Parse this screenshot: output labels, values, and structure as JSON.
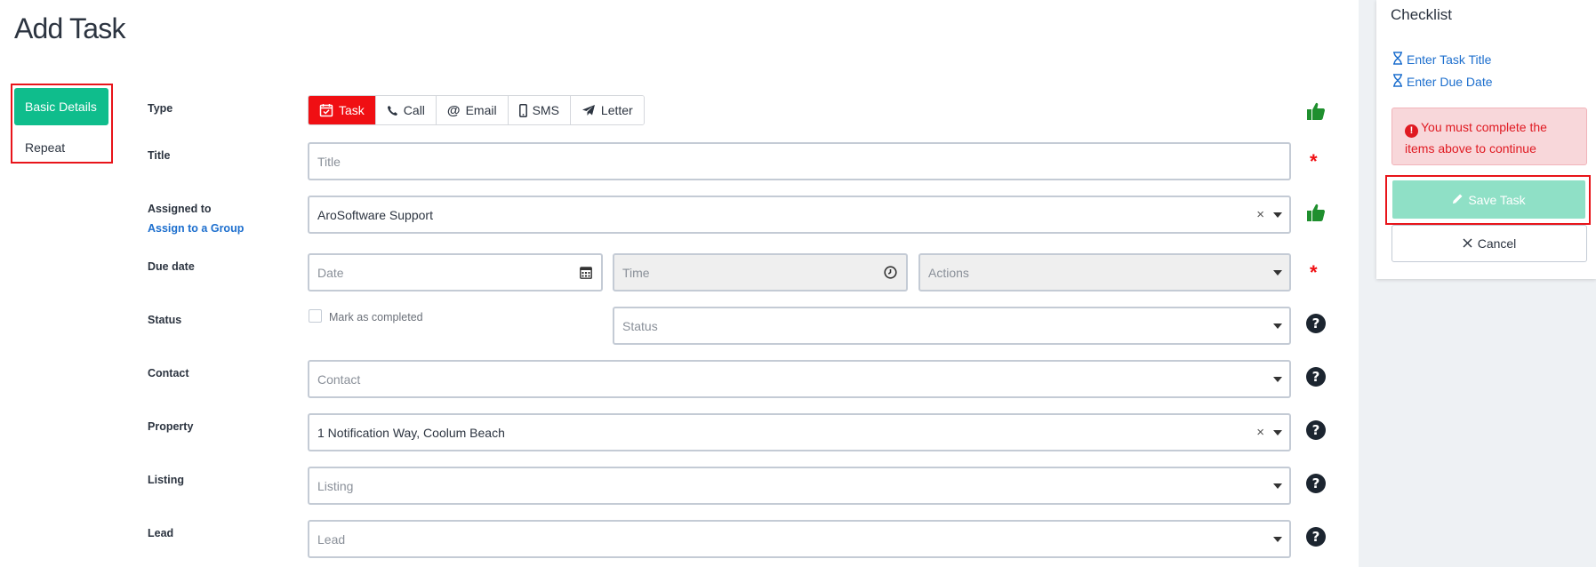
{
  "page": {
    "title": "Add Task"
  },
  "tabs": [
    {
      "label": "Basic Details",
      "active": true
    },
    {
      "label": "Repeat",
      "active": false
    }
  ],
  "form": {
    "type": {
      "label": "Type",
      "options": [
        {
          "label": "Task",
          "icon": "calendar-check-icon",
          "active": true
        },
        {
          "label": "Call",
          "icon": "phone-icon",
          "active": false
        },
        {
          "label": "Email",
          "icon": "at-icon",
          "active": false
        },
        {
          "label": "SMS",
          "icon": "mobile-icon",
          "active": false
        },
        {
          "label": "Letter",
          "icon": "paper-plane-icon",
          "active": false
        }
      ],
      "status_icon": "thumbs-up-icon"
    },
    "title": {
      "label": "Title",
      "placeholder": "Title",
      "status_icon": "required-asterisk-icon"
    },
    "assigned_to": {
      "label": "Assigned to",
      "link": "Assign to a Group",
      "value": "AroSoftware Support",
      "clear": "×",
      "status_icon": "thumbs-up-icon"
    },
    "due_date": {
      "label": "Due date",
      "date_placeholder": "Date",
      "time_placeholder": "Time",
      "actions_placeholder": "Actions",
      "status_icon": "required-asterisk-icon"
    },
    "status": {
      "label": "Status",
      "checkbox_label": "Mark as completed",
      "placeholder": "Status",
      "status_icon": "help-icon"
    },
    "contact": {
      "label": "Contact",
      "placeholder": "Contact",
      "status_icon": "help-icon"
    },
    "property": {
      "label": "Property",
      "value": "1 Notification Way, Coolum Beach",
      "clear": "×",
      "status_icon": "help-icon"
    },
    "listing": {
      "label": "Listing",
      "placeholder": "Listing",
      "status_icon": "help-icon"
    },
    "lead": {
      "label": "Lead",
      "placeholder": "Lead",
      "status_icon": "help-icon"
    }
  },
  "checklist": {
    "title": "Checklist",
    "items": [
      {
        "label": "Enter Task Title",
        "icon": "hourglass-icon"
      },
      {
        "label": "Enter Due Date",
        "icon": "hourglass-icon"
      }
    ],
    "alert": "You must complete the items above to continue",
    "save_label": "Save Task",
    "cancel_label": "Cancel"
  },
  "colors": {
    "accent": "#0fbd8c",
    "active_type": "#f00f13",
    "link": "#1d6fce",
    "alert_bg": "#f8d7da",
    "save_disabled": "#8fe0c6",
    "thumbs_up": "#1f8f2e",
    "highlight_border": "#e8141a"
  }
}
